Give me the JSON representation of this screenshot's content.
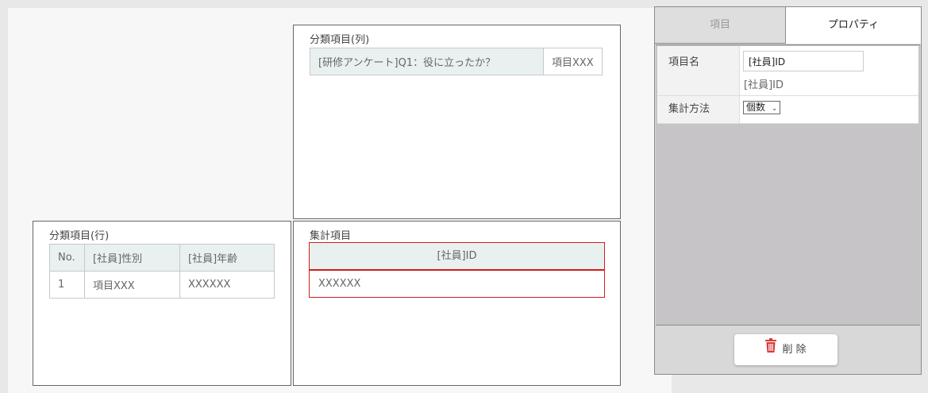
{
  "column_panel": {
    "title": "分類項目(列)",
    "cells": [
      "[研修アンケート]Q1：役に立ったか？",
      "項目XXX"
    ]
  },
  "row_panel": {
    "title": "分類項目(行)",
    "headers": [
      "No.",
      "[社員]性別",
      "[社員]年齢"
    ],
    "rows": [
      [
        "1",
        "項目XXX",
        "XXXXXX"
      ]
    ]
  },
  "aggregate_panel": {
    "title": "集計項目",
    "header": "[社員]ID",
    "value": "XXXXXX"
  },
  "properties": {
    "tabs": [
      "項目",
      "プロパティ"
    ],
    "active_tab": "プロパティ",
    "name_label": "項目名",
    "name_value": "[社員]ID",
    "name_original": "[社員]ID",
    "method_label": "集計方法",
    "method_value": "個数",
    "delete_label": "削 除"
  },
  "colors": {
    "selected_border": "#d21c1c",
    "header_bg": "#e9f1f0",
    "delete_icon": "#d93a3a"
  }
}
